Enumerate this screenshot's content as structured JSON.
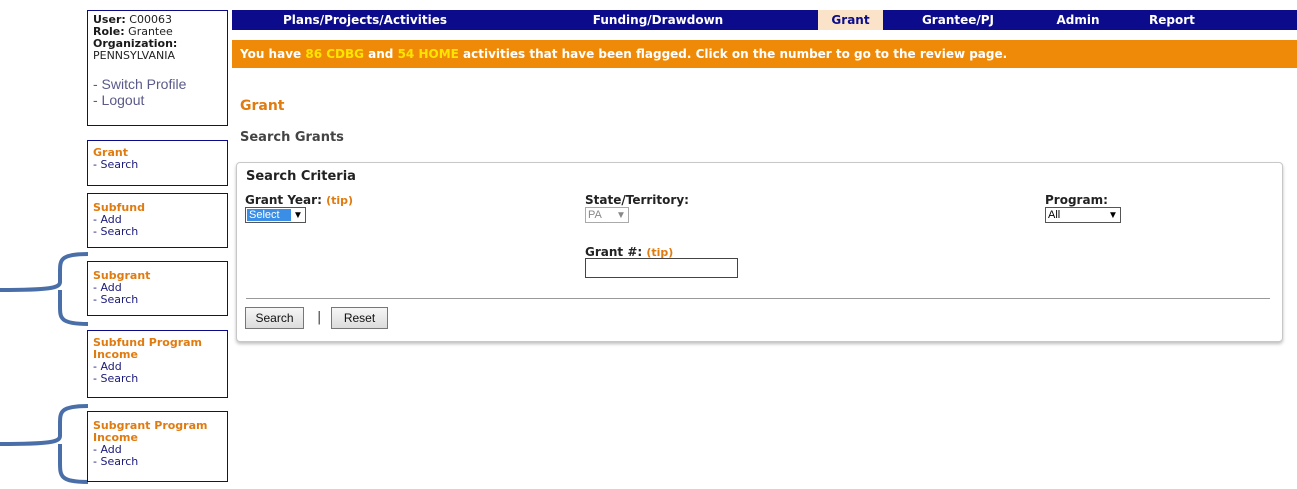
{
  "user": {
    "user_label": "User:",
    "user_value": "C00063",
    "role_label": "Role:",
    "role_value": "Grantee",
    "org_label": "Organization:",
    "org_value": "PENNSYLVANIA",
    "switch_profile": "- Switch Profile",
    "logout": "- Logout"
  },
  "sidebar": {
    "grant": {
      "title": "Grant",
      "links": [
        "- Search"
      ]
    },
    "subfund": {
      "title": "Subfund",
      "links": [
        "- Add",
        "- Search"
      ]
    },
    "subgrant": {
      "title": "Subgrant",
      "links": [
        "- Add",
        "- Search"
      ]
    },
    "subfund_pi": {
      "title_line1": "Subfund Program",
      "title_line2": "Income",
      "links": [
        "- Add",
        "- Search"
      ]
    },
    "subgrant_pi": {
      "title_line1": "Subgrant Program",
      "title_line2": "Income",
      "links": [
        "- Add",
        "- Search"
      ]
    }
  },
  "nav": {
    "items": [
      "Plans/Projects/Activities",
      "Funding/Drawdown",
      "Grant",
      "Grantee/PJ",
      "Admin",
      "Report"
    ],
    "active": "Grant"
  },
  "alert": {
    "prefix": "You have ",
    "cdbg_count": "86 CDBG",
    "mid": " and ",
    "home_count": "54 HOME",
    "suffix": " activities that have been flagged. Click on the number to go to the review page."
  },
  "page": {
    "title": "Grant",
    "subtitle": "Search Grants"
  },
  "search": {
    "panel_title": "Search Criteria",
    "grant_year_label": "Grant Year:",
    "tip": "(tip)",
    "grant_year_value": "Select",
    "state_label": "State/Territory:",
    "state_value": "PA",
    "program_label": "Program:",
    "program_value": "All",
    "grant_num_label": "Grant #:",
    "grant_num_value": "",
    "search_button": "Search",
    "separator": "|",
    "reset_button": "Reset"
  },
  "colors": {
    "nav_bg": "#0b0b8c",
    "accent_orange": "#e07b10",
    "alert_bg": "#ef8a08",
    "alert_highlight": "#ffe400",
    "bracket": "#4a6fa8"
  }
}
